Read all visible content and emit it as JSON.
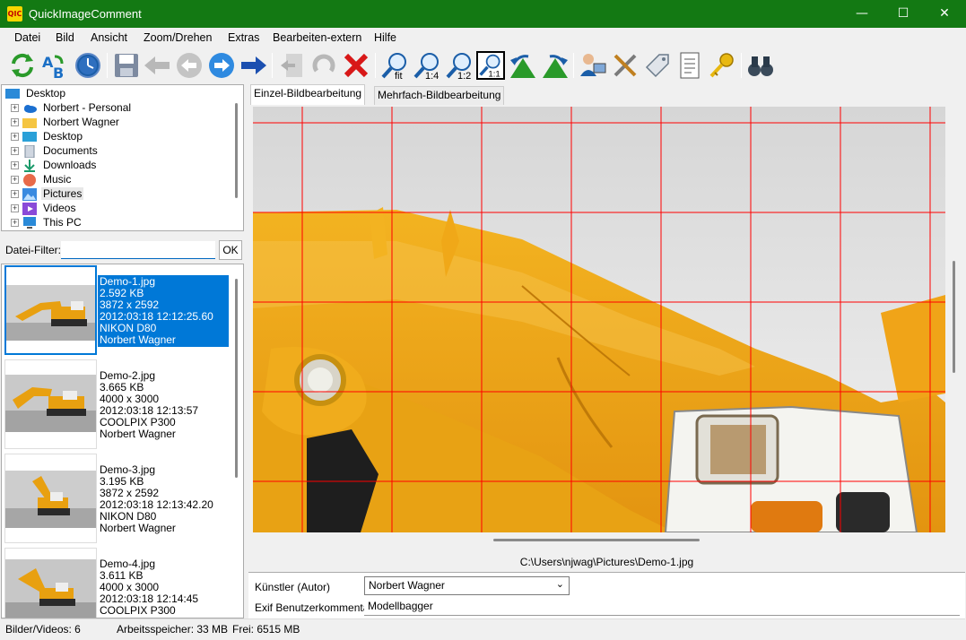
{
  "window": {
    "title": "QuickImageComment",
    "app_icon_text": "QIC",
    "minimize": "—",
    "maximize": "☐",
    "close": "✕"
  },
  "menu": [
    "Datei",
    "Bild",
    "Ansicht",
    "Zoom/Drehen",
    "Extras",
    "Bearbeiten-extern",
    "Hilfe"
  ],
  "toolbar": {
    "zoom_fit": "fit",
    "zoom_1_4": "1:4",
    "zoom_1_2": "1:2",
    "zoom_1_1": "1:1"
  },
  "tree": {
    "root": "Desktop",
    "items": [
      "Norbert - Personal",
      "Norbert Wagner",
      "Desktop",
      "Documents",
      "Downloads",
      "Music",
      "Pictures",
      "Videos",
      "This PC"
    ]
  },
  "filter": {
    "label": "Datei-Filter:",
    "value": "",
    "ok": "OK"
  },
  "files": [
    {
      "name": "Demo-1.jpg",
      "size": "2.592 KB",
      "dims": "3872 x 2592",
      "date": "2012:03:18 12:12:25.60",
      "camera": "NIKON D80",
      "author": "Norbert Wagner",
      "selected": true
    },
    {
      "name": "Demo-2.jpg",
      "size": "3.665 KB",
      "dims": "4000 x 3000",
      "date": "2012:03:18 12:13:57",
      "camera": "COOLPIX P300",
      "author": "Norbert Wagner",
      "selected": false
    },
    {
      "name": "Demo-3.jpg",
      "size": "3.195 KB",
      "dims": "3872 x 2592",
      "date": "2012:03:18 12:13:42.20",
      "camera": "NIKON D80",
      "author": "Norbert Wagner",
      "selected": false
    },
    {
      "name": "Demo-4.jpg",
      "size": "3.611 KB",
      "dims": "4000 x 3000",
      "date": "2012:03:18 12:14:45",
      "camera": "COOLPIX P300",
      "author": "",
      "selected": false
    }
  ],
  "tabs": {
    "single": "Einzel-Bildbearbeitung",
    "multi": "Mehrfach-Bildbearbeitung"
  },
  "image_path": "C:\\Users\\njwag\\Pictures\\Demo-1.jpg",
  "properties": {
    "artist_label": "Künstler (Autor)",
    "artist_value": "Norbert Wagner",
    "comment_label": "Exif Benutzerkommentar",
    "comment_value": "Modellbagger"
  },
  "status": {
    "count": "Bilder/Videos: 6",
    "memory": "Arbeitsspeicher: 33 MB",
    "free": "Frei: 6515 MB"
  },
  "colors": {
    "titlebar": "#137913",
    "selection": "#0078d7",
    "grid": "#ff0000"
  }
}
